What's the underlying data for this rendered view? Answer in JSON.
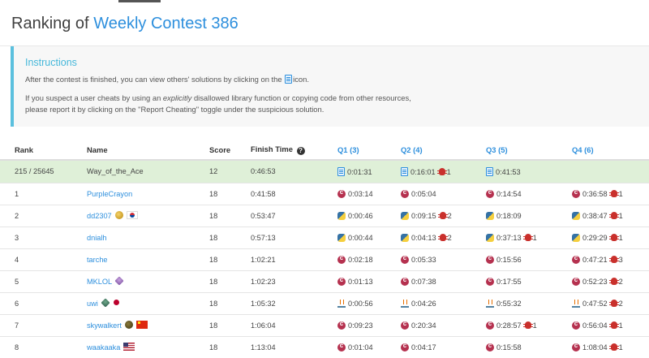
{
  "header": {
    "title_prefix": "Ranking of",
    "title_contest": "Weekly Contest 386"
  },
  "instructions": {
    "title": "Instructions",
    "line1_before": "After the contest is finished, you can view others' solutions by clicking on the",
    "line1_after": "icon.",
    "line2_before": "If you suspect a user cheats by using an",
    "line2_em": "explicitly",
    "line2_after": "disallowed library function or copying code from other resources,",
    "line3": "please report it by clicking on the \"Report Cheating\" toggle under the suspicious solution."
  },
  "table": {
    "headers": {
      "rank": "Rank",
      "name": "Name",
      "score": "Score",
      "finish_time": "Finish Time",
      "q1": "Q1 (3)",
      "q2": "Q2 (4)",
      "q3": "Q3 (5)",
      "q4": "Q4 (6)"
    },
    "rows": [
      {
        "rank": "215 / 25645",
        "name": "Way_of_the_Ace",
        "score": "12",
        "time": "0:46:53",
        "q1": "0:01:31",
        "q2": "0:16:01",
        "q2_bugs": "1",
        "q3": "0:41:53",
        "q4": ""
      },
      {
        "rank": "1",
        "name": "PurpleCrayon",
        "score": "18",
        "time": "0:41:58",
        "q1": "0:03:14",
        "q2": "0:05:04",
        "q3": "0:14:54",
        "q4": "0:36:58",
        "q4_bugs": "1"
      },
      {
        "rank": "2",
        "name": "dd2307",
        "score": "18",
        "time": "0:53:47",
        "q1": "0:00:46",
        "q2": "0:09:15",
        "q2_bugs": "2",
        "q3": "0:18:09",
        "q4": "0:38:47",
        "q4_bugs": "1"
      },
      {
        "rank": "3",
        "name": "dnialh",
        "score": "18",
        "time": "0:57:13",
        "q1": "0:00:44",
        "q2": "0:04:13",
        "q2_bugs": "2",
        "q3": "0:37:13",
        "q3_bugs": "1",
        "q4": "0:29:29",
        "q4_bugs": "1"
      },
      {
        "rank": "4",
        "name": "tarche",
        "score": "18",
        "time": "1:02:21",
        "q1": "0:02:18",
        "q2": "0:05:33",
        "q3": "0:15:56",
        "q4": "0:47:21",
        "q4_bugs": "3"
      },
      {
        "rank": "5",
        "name": "MKLOL",
        "score": "18",
        "time": "1:02:23",
        "q1": "0:01:13",
        "q2": "0:07:38",
        "q3": "0:17:55",
        "q4": "0:52:23",
        "q4_bugs": "2"
      },
      {
        "rank": "6",
        "name": "uwi",
        "score": "18",
        "time": "1:05:32",
        "q1": "0:00:56",
        "q2": "0:04:26",
        "q3": "0:55:32",
        "q4": "0:47:52",
        "q4_bugs": "2"
      },
      {
        "rank": "7",
        "name": "skywalkert",
        "score": "18",
        "time": "1:06:04",
        "q1": "0:09:23",
        "q2": "0:20:34",
        "q3": "0:28:57",
        "q3_bugs": "1",
        "q4": "0:56:04",
        "q4_bugs": "1"
      },
      {
        "rank": "8",
        "name": "waakaaka",
        "score": "18",
        "time": "1:13:04",
        "q1": "0:01:04",
        "q2": "0:04:17",
        "q3": "0:15:58",
        "q4": "1:08:04",
        "q4_bugs": "1"
      }
    ]
  },
  "icons": {
    "help": "question-circle-icon",
    "solution_doc": "solution-doc-icon",
    "cpp": "cpp-icon",
    "python": "python-icon",
    "java": "java-icon",
    "bug": "bug-icon"
  },
  "colors": {
    "accent_blue": "#2d8fdd",
    "info_border": "#5bc0de",
    "my_row_bg": "#dff0d8",
    "bug_red": "#c9302c"
  }
}
